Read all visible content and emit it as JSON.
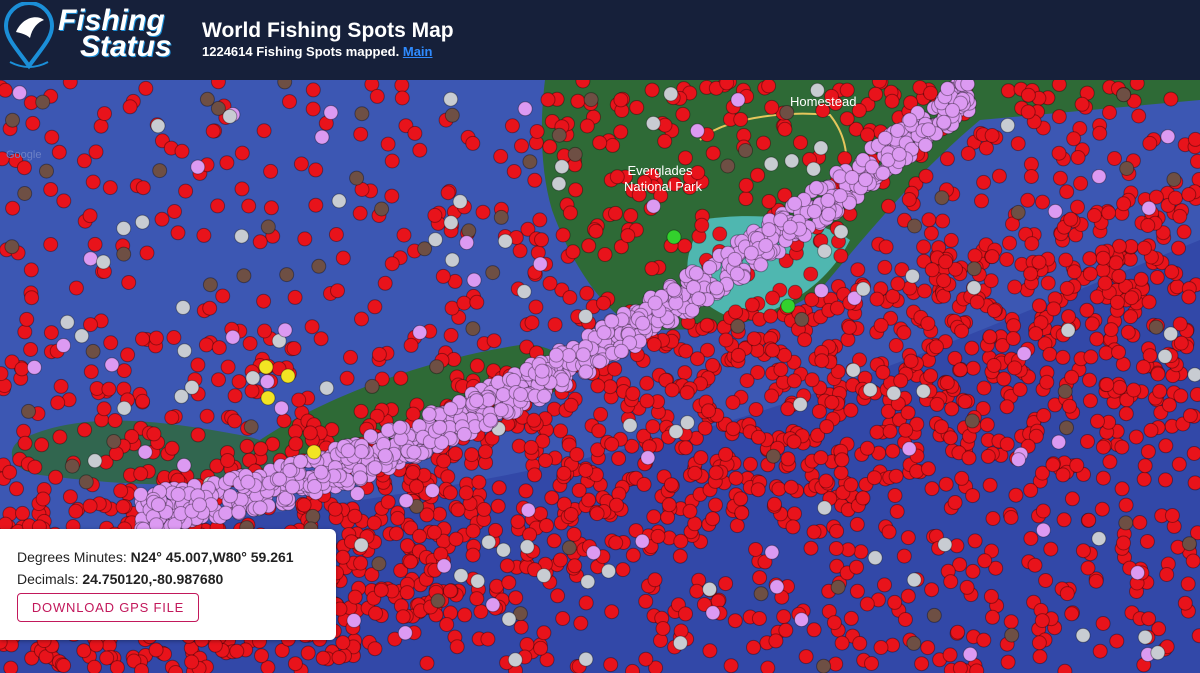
{
  "header": {
    "logo_line1": "Fishing",
    "logo_line2": "Status",
    "title": "World Fishing Spots Map",
    "subtitle_count": "1224614 Fishing Spots mapped.",
    "main_link": "Main"
  },
  "map": {
    "labels": {
      "park_line1": "Everglades",
      "park_line2": "National Park",
      "city": "Homestead",
      "watermark": "Google"
    },
    "colors": {
      "ocean": "#3c57b3",
      "deep_ocean": "#2b3ea0",
      "land": "#2e6a36",
      "shallows": "#4fb7b0",
      "spot_red": "#e8131b",
      "spot_violet": "#dc9af2",
      "spot_gray": "#c8ccd2",
      "spot_brown": "#6e4f44",
      "spot_yellow": "#f2e423",
      "spot_green": "#33d12d"
    }
  },
  "info": {
    "dm_label": "Degrees Minutes:",
    "dm_value": "N24° 45.007,W80° 59.261",
    "dec_label": "Decimals:",
    "dec_value": "24.750120,-80.987680",
    "download_label": "DOWNLOAD GPS FILE"
  }
}
